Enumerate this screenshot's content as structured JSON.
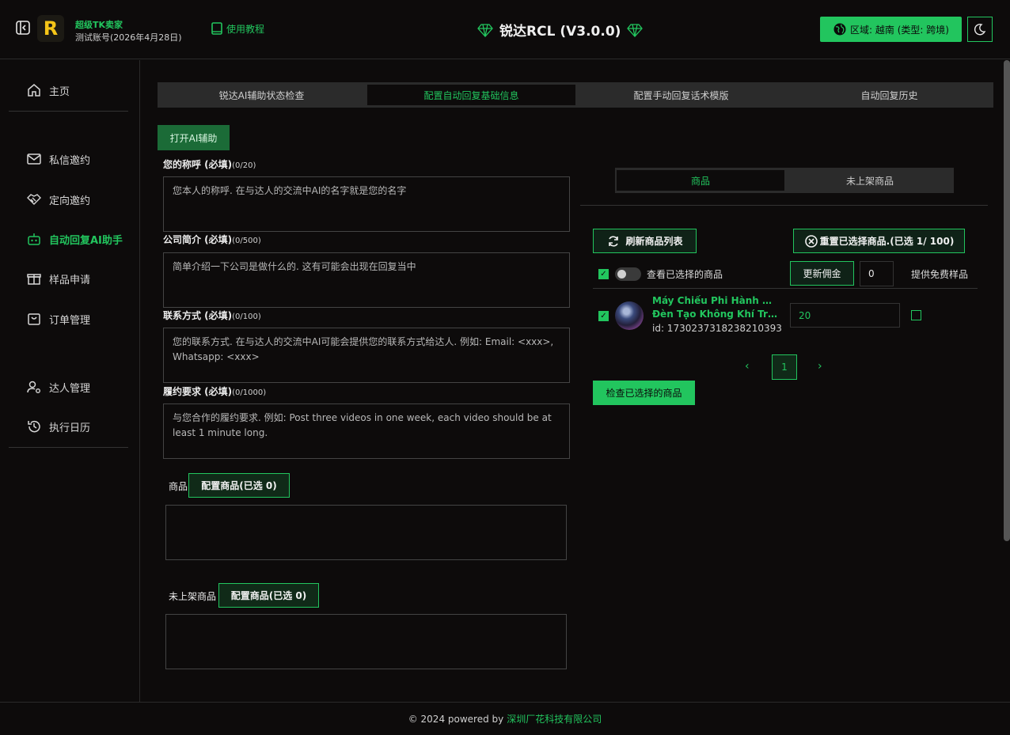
{
  "header": {
    "app_name": "超级TK卖家",
    "account": "测试账号(2026年4月28日)",
    "tutorial": "使用教程",
    "title": "锐达RCL (V3.0.0)",
    "region": "区域: 越南 (类型: 跨境)",
    "logo_letter": "R"
  },
  "sidebar": {
    "items": [
      {
        "label": "主页",
        "icon": "home-icon"
      },
      {
        "label": "私信邀约",
        "icon": "mail-icon"
      },
      {
        "label": "定向邀约",
        "icon": "handshake-icon"
      },
      {
        "label": "自动回复AI助手",
        "icon": "robot-icon",
        "active": true
      },
      {
        "label": "样品申请",
        "icon": "gift-icon"
      },
      {
        "label": "订单管理",
        "icon": "bag-icon"
      },
      {
        "label": "达人管理",
        "icon": "user-cog-icon"
      },
      {
        "label": "执行日历",
        "icon": "history-icon"
      }
    ]
  },
  "tabs": [
    "锐达AI辅助状态检查",
    "配置自动回复基础信息",
    "配置手动回复话术模版",
    "自动回复历史"
  ],
  "ai_button": "打开AI辅助",
  "form": {
    "name": {
      "label": "您的称呼 (必填)",
      "count": "(0/20)",
      "placeholder": "您本人的称呼. 在与达人的交流中AI的名字就是您的名字"
    },
    "company": {
      "label": "公司简介 (必填)",
      "count": "(0/500)",
      "placeholder": "简单介绍一下公司是做什么的. 这有可能会出现在回复当中"
    },
    "contact": {
      "label": "联系方式 (必填)",
      "count": "(0/100)",
      "placeholder": "您的联系方式. 在与达人的交流中AI可能会提供您的联系方式给达人. 例如: Email: <xxx>, Whatsapp: <xxx>"
    },
    "requirement": {
      "label": "履约要求 (必填)",
      "count": "(0/1000)",
      "placeholder": "与您合作的履约要求. 例如: Post three videos in one week, each video should be at least 1 minute long."
    },
    "products_label": "商品",
    "products_button": "配置商品(已选 0)",
    "unlisted_label": "未上架商品",
    "unlisted_button": "配置商品(已选 0)"
  },
  "panel": {
    "segments": [
      "商品",
      "未上架商品"
    ],
    "refresh": "刷新商品列表",
    "reset": "重置已选择商品.(已选 1/ 100)",
    "view_selected": "查看已选择的商品",
    "update_commission": "更新佣金",
    "commission_value": "0",
    "free_sample": "提供免费样品",
    "product": {
      "name_line1": "Máy Chiếu Phi Hành Gia,",
      "name_line2": "Đèn Tạo Không Khí Tro...",
      "id": "id: 1730237318238210393",
      "commission": "20"
    },
    "page": "1",
    "check_selected": "检查已选择的商品"
  },
  "footer": {
    "text": "© 2024 powered by",
    "company": "深圳厂花科技有限公司"
  }
}
